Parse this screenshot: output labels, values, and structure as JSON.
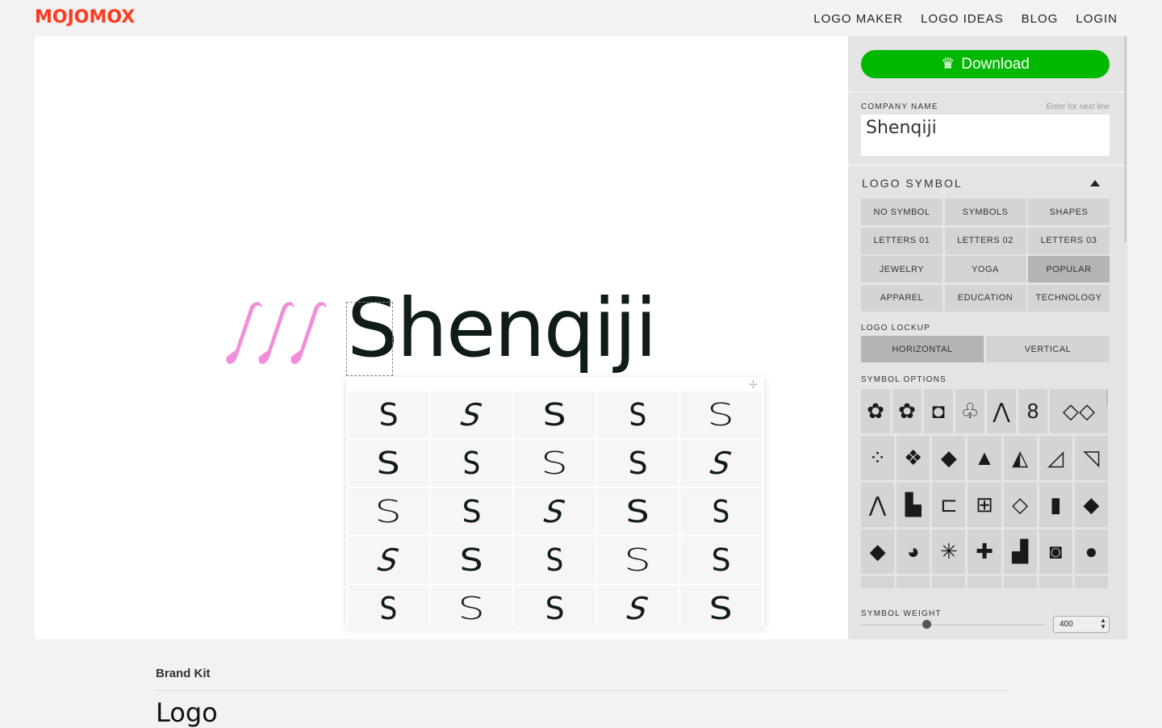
{
  "header": {
    "brand": "MOJOMOX",
    "nav": [
      "LOGO MAKER",
      "LOGO IDEAS",
      "BLOG",
      "LOGIN"
    ]
  },
  "canvas": {
    "company_name": "Shenqiji",
    "symbol_color": "#f08fd8",
    "text_color": "#101c16",
    "glyph_options": [
      "S",
      "S",
      "S",
      "S",
      "S",
      "S",
      "S",
      "S",
      "S",
      "S",
      "S",
      "S",
      "S",
      "S",
      "S",
      "S",
      "S",
      "S",
      "S",
      "S",
      "S",
      "S",
      "S",
      "S",
      "S"
    ]
  },
  "sidebar": {
    "download_label": "Download",
    "download_icon": "crown-icon",
    "accent": "#00b800",
    "company_name_label": "COMPANY NAME",
    "company_name_hint": "Enter for next line",
    "company_name_value": "Shenqiji",
    "logo_symbol_title": "LOGO SYMBOL",
    "categories": [
      {
        "label": "NO SYMBOL"
      },
      {
        "label": "SYMBOLS"
      },
      {
        "label": "SHAPES"
      },
      {
        "label": "LETTERS 01"
      },
      {
        "label": "LETTERS 02"
      },
      {
        "label": "LETTERS 03"
      },
      {
        "label": "JEWELRY"
      },
      {
        "label": "YOGA"
      },
      {
        "label": "POPULAR",
        "selected": true
      },
      {
        "label": "APPAREL"
      },
      {
        "label": "EDUCATION"
      },
      {
        "label": "TECHNOLOGY"
      }
    ],
    "lockup_label": "LOGO LOCKUP",
    "lockup": [
      {
        "label": "HORIZONTAL",
        "selected": true
      },
      {
        "label": "VERTICAL"
      }
    ],
    "symbol_options_label": "SYMBOL OPTIONS",
    "symbol_options": [
      [
        "✿",
        "✿",
        "◘",
        "♧",
        "⋀",
        "8",
        "◇◇"
      ],
      [
        "⁘",
        "❖",
        "◆",
        "▲",
        "◭",
        "◿",
        "◹"
      ],
      [
        "⋀",
        "▙",
        "⊏",
        "⊞",
        "◇",
        "▮",
        "◆"
      ],
      [
        "◆",
        "◕",
        "✳",
        "✚",
        "▟",
        "◙",
        "●"
      ],
      [
        "▲",
        "▣",
        "▣",
        "▲",
        "▲",
        "△",
        "◠"
      ]
    ],
    "symbol_weight_label": "SYMBOL WEIGHT",
    "symbol_weight": "400"
  },
  "footer": {
    "brand_kit": "Brand Kit",
    "logo_heading": "Logo"
  }
}
